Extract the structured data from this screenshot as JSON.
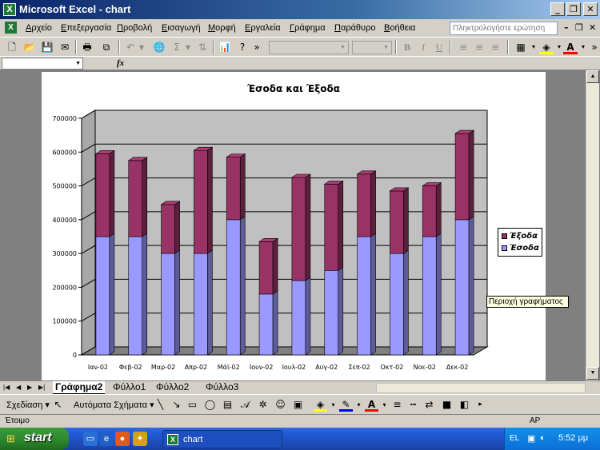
{
  "window": {
    "title": "Microsoft Excel - chart",
    "app_icon": "X"
  },
  "menubar": {
    "items": [
      "Αρχείο",
      "Επεξεργασία",
      "Προβολή",
      "Εισαγωγή",
      "Μορφή",
      "Εργαλεία",
      "Γράφημα",
      "Παράθυρο",
      "Βοήθεια"
    ],
    "ask_placeholder": "Πληκτρολογήστε ερώτηση"
  },
  "formula_bar": {
    "fx_label": "fx"
  },
  "chart_data": {
    "type": "bar",
    "stacked": true,
    "style": "3d-column",
    "title": "Έσοδα και Έξοδα",
    "categories": [
      "Ιαν-02",
      "Φεβ-02",
      "Μαρ-02",
      "Απρ-02",
      "Μάϊ-02",
      "Ιουν-02",
      "Ιουλ-02",
      "Αυγ-02",
      "Σεπ-02",
      "Οκτ-02",
      "Νοε-02",
      "Δεκ-02"
    ],
    "series": [
      {
        "name": "Έσοδα",
        "color": "#9999ff",
        "values": [
          350000,
          350000,
          300000,
          300000,
          400000,
          180000,
          220000,
          250000,
          350000,
          300000,
          350000,
          400000
        ]
      },
      {
        "name": "Έξοδα",
        "color": "#993366",
        "values": [
          245000,
          225000,
          145000,
          305000,
          185000,
          155000,
          305000,
          255000,
          185000,
          185000,
          150000,
          255000
        ]
      }
    ],
    "yticks": [
      "0",
      "100000",
      "200000",
      "300000",
      "400000",
      "500000",
      "600000",
      "700000"
    ],
    "ylim": [
      0,
      700000
    ],
    "grid": true,
    "legend_position": "right",
    "tooltip": "Περιοχή γραφήματος",
    "colors": {
      "wall": "#c0c0c0",
      "floor": "#808080"
    }
  },
  "sheet_tabs": {
    "items": [
      "Γράφημα2",
      "Φύλλο1",
      "Φύλλο2",
      "Φύλλο3"
    ],
    "active": 0
  },
  "draw_toolbar": {
    "draw_label": "Σχεδίαση",
    "autoshapes_label": "Αυτόματα Σχήματα"
  },
  "status": {
    "text": "Έτοιμο",
    "indicator": "ΑΡ"
  },
  "taskbar": {
    "start_label": "start",
    "task_label": "chart",
    "lang": "EL",
    "clock": "5:52 μμ"
  }
}
